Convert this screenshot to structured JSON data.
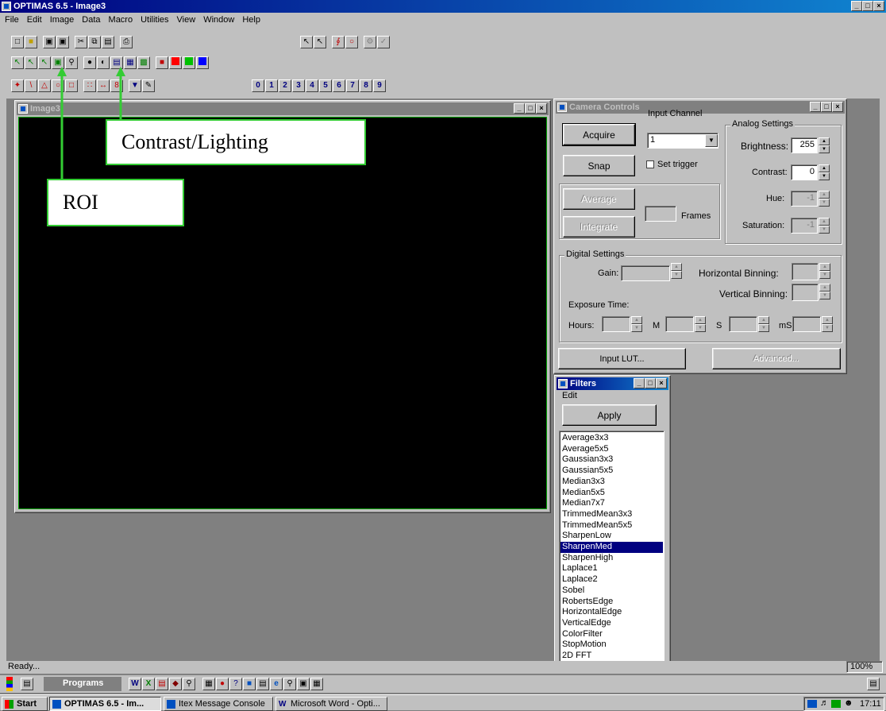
{
  "app": {
    "title": "OPTIMAS 6.5 - Image3",
    "menu": [
      "File",
      "Edit",
      "Image",
      "Data",
      "Macro",
      "Utilities",
      "View",
      "Window",
      "Help"
    ],
    "controls": [
      "_",
      "□",
      "×"
    ]
  },
  "toolbar": {
    "number_buttons": [
      "0",
      "1",
      "2",
      "3",
      "4",
      "5",
      "6",
      "7",
      "8",
      "9"
    ]
  },
  "image_window": {
    "title": "Image3"
  },
  "annotations": {
    "roi_label": "ROI",
    "contrast_label": "Contrast/Lighting",
    "arrow_color": "#33cc33"
  },
  "camera": {
    "title": "Camera Controls",
    "acquire": "Acquire",
    "snap": "Snap",
    "average": "Average",
    "integrate": "Integrate",
    "frames_label": "Frames",
    "input_channel_label": "Input Channel",
    "input_channel_value": "1",
    "set_trigger_label": "Set trigger",
    "analog_group": "Analog Settings",
    "brightness_label": "Brightness:",
    "brightness_value": "255",
    "contrast_label": "Contrast:",
    "contrast_value": "0",
    "hue_label": "Hue:",
    "hue_value": "-1",
    "saturation_label": "Saturation:",
    "saturation_value": "-1",
    "digital_group": "Digital Settings",
    "gain_label": "Gain:",
    "hbin_label": "Horizontal Binning:",
    "vbin_label": "Vertical Binning:",
    "exposure_label": "Exposure Time:",
    "hours_label": "Hours:",
    "m_label": "M",
    "s_label": "S",
    "ms_label": "mS",
    "input_lut": "Input LUT...",
    "advanced": "Advanced..."
  },
  "filters": {
    "title": "Filters",
    "menu_edit": "Edit",
    "apply": "Apply",
    "selected": "SharpenMed",
    "items": [
      "Average3x3",
      "Average5x5",
      "Gaussian3x3",
      "Gaussian5x5",
      "Median3x3",
      "Median5x5",
      "Median7x7",
      "TrimmedMean3x3",
      "TrimmedMean5x5",
      "SharpenLow",
      "SharpenMed",
      "SharpenHigh",
      "Laplace1",
      "Laplace2",
      "Sobel",
      "RobertsEdge",
      "HorizontalEdge",
      "VerticalEdge",
      "ColorFilter",
      "StopMotion",
      "2D FFT"
    ]
  },
  "status": {
    "text": "Ready...",
    "zoom": "100%"
  },
  "office_bar": {
    "programs": "Programs"
  },
  "taskbar": {
    "start": "Start",
    "tasks": [
      "OPTIMAS 6.5 - Im...",
      "Itex Message Console",
      "Microsoft Word - Opti..."
    ],
    "clock": "17:11"
  }
}
